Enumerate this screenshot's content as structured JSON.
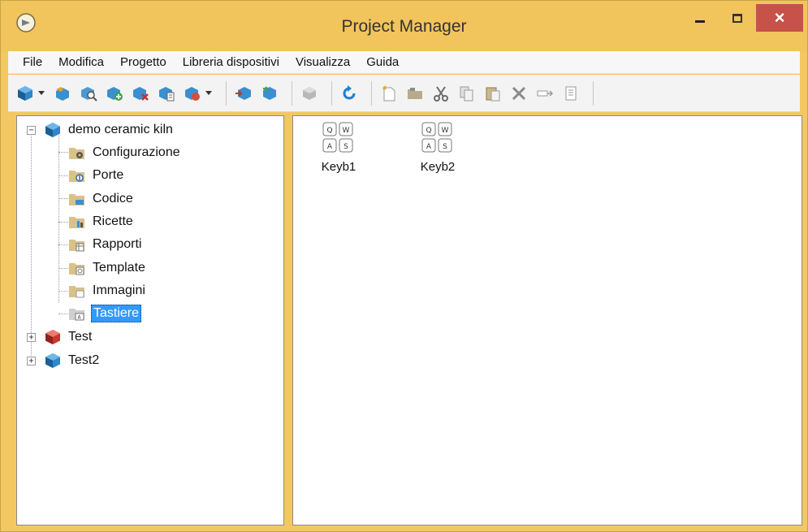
{
  "window": {
    "title": "Project Manager",
    "accent": "#f2c45c",
    "close_color": "#c7524a",
    "selection_color": "#3399ff"
  },
  "menu": [
    {
      "label": "File"
    },
    {
      "label": "Modifica"
    },
    {
      "label": "Progetto"
    },
    {
      "label": "Libreria dispositivi"
    },
    {
      "label": "Visualizza"
    },
    {
      "label": "Guida"
    }
  ],
  "toolbar": {
    "icons": [
      "new-project-icon",
      "open-project-icon",
      "search-project-icon",
      "add-project-icon",
      "remove-project-icon",
      "project-properties-icon",
      "project-menu-icon",
      "import-icon",
      "export-icon",
      "compile-icon",
      "refresh-icon",
      "new-item-icon",
      "folder-icon",
      "cut-icon",
      "copy-icon",
      "paste-icon",
      "delete-icon",
      "rename-icon",
      "properties-icon"
    ]
  },
  "tree": {
    "projects": [
      {
        "label": "demo ceramic kiln",
        "expanded": true
      },
      {
        "label": "Test",
        "expanded": false
      },
      {
        "label": "Test2",
        "expanded": false
      }
    ],
    "children": [
      {
        "label": "Configurazione",
        "icon": "configuration-folder-icon"
      },
      {
        "label": "Porte",
        "icon": "ports-folder-icon"
      },
      {
        "label": "Codice",
        "icon": "code-folder-icon"
      },
      {
        "label": "Ricette",
        "icon": "recipes-folder-icon"
      },
      {
        "label": "Rapporti",
        "icon": "reports-folder-icon"
      },
      {
        "label": "Template",
        "icon": "template-folder-icon"
      },
      {
        "label": "Immagini",
        "icon": "images-folder-icon"
      },
      {
        "label": "Tastiere",
        "icon": "keyboards-folder-icon",
        "selected": true
      }
    ]
  },
  "content": {
    "items": [
      {
        "label": "Keyb1",
        "keys": [
          "Q",
          "W",
          "A",
          "S"
        ]
      },
      {
        "label": "Keyb2",
        "keys": [
          "Q",
          "W",
          "A",
          "S"
        ]
      }
    ]
  }
}
